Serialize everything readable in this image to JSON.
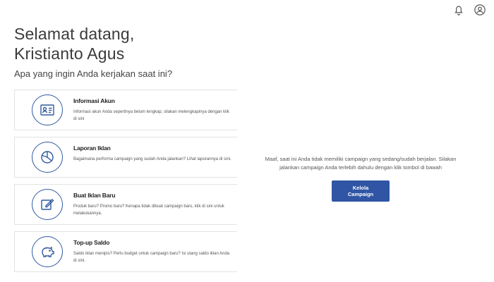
{
  "header": {
    "icons": [
      "bell-icon",
      "user-circle-icon"
    ]
  },
  "welcome": {
    "line1": "Selamat datang,",
    "line2": "Kristianto Agus",
    "subtitle": "Apa yang ingin Anda kerjakan saat ini?"
  },
  "cards": [
    {
      "icon": "id-card-icon",
      "title": "Informasi Akun",
      "desc": "Informasi akun Anda sepertinya belum lengkap, silakan melengkapinya dengan klik di sini"
    },
    {
      "icon": "pie-chart-icon",
      "title": "Laporan Iklan",
      "desc": "Bagaimana performa campaign yang sudah Anda jalankan? Lihat laporannya di sini."
    },
    {
      "icon": "edit-icon",
      "title": "Buat Iklan Baru",
      "desc": "Produk baru? Promo baru? Kenapa tidak dibuat campaign baru, klik di sini untuk melakukannya."
    },
    {
      "icon": "piggy-bank-icon",
      "title": "Top-up Saldo",
      "desc": "Saldo iklan menipis? Perlu budget untuk campaign baru? Isi ulang saldo iklan Anda di sini."
    }
  ],
  "empty_state": {
    "message": "Maaf, saat ini Anda tidak memiliki campaign yang sedang/sudah berjalan. Silakan jalankan campaign Anda terlebih dahulu dengan klik tombol di bawah",
    "button_label": "Kelola Campaign"
  },
  "colors": {
    "accent": "#2f55a4"
  }
}
